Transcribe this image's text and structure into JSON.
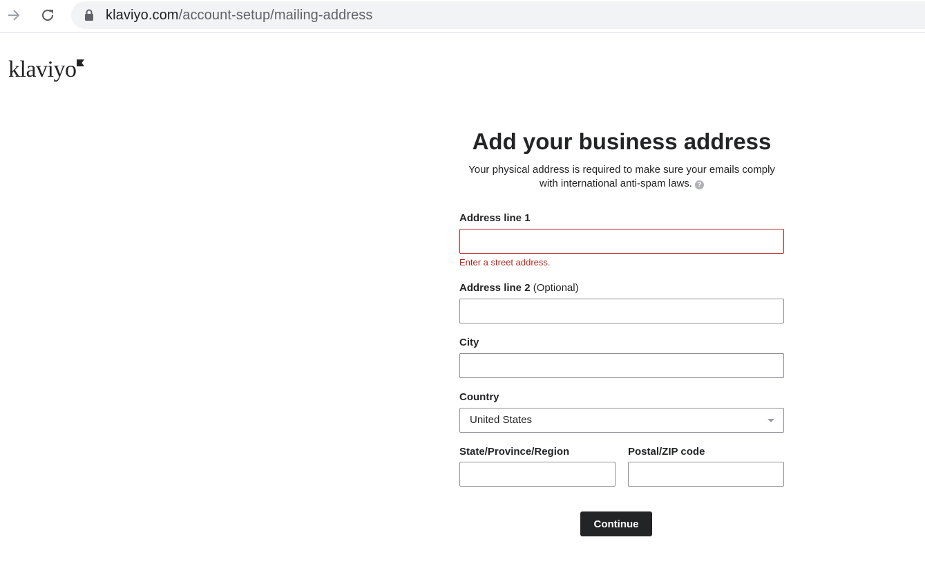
{
  "browser": {
    "url_host": "klaviyo.com",
    "url_path": "/account-setup/mailing-address"
  },
  "brand": {
    "logo_text": "klaviyo"
  },
  "form": {
    "title": "Add your business address",
    "subtitle": "Your physical address is required to make sure your emails comply with international anti-spam laws.",
    "help_icon_glyph": "?",
    "address1": {
      "label": "Address line 1",
      "value": "",
      "error": "Enter a street address."
    },
    "address2": {
      "label": "Address line 2",
      "optional": "(Optional)",
      "value": ""
    },
    "city": {
      "label": "City",
      "value": ""
    },
    "country": {
      "label": "Country",
      "selected": "United States"
    },
    "state": {
      "label": "State/Province/Region",
      "value": ""
    },
    "postal": {
      "label": "Postal/ZIP code",
      "value": ""
    },
    "continue_label": "Continue"
  },
  "colors": {
    "error": "#b3261e",
    "primary_button": "#232426",
    "input_border": "#8d8f93"
  }
}
